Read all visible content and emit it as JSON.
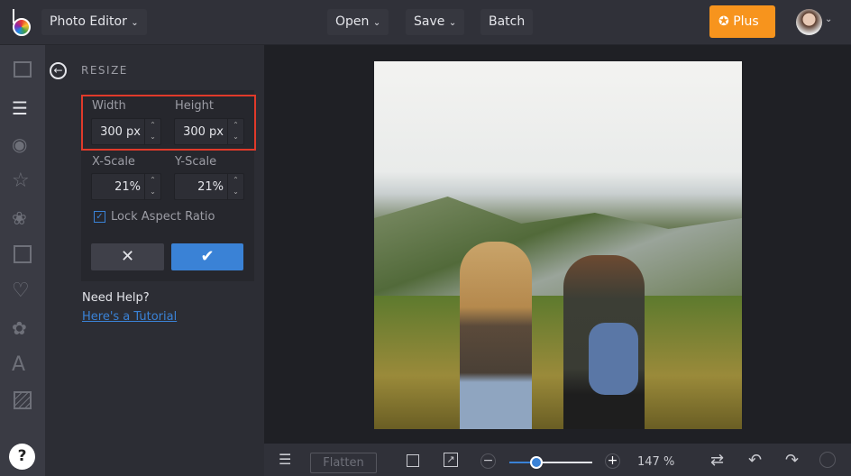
{
  "header": {
    "app_menu": "Photo Editor",
    "open": "Open",
    "save": "Save",
    "batch": "Batch",
    "plus": "Plus"
  },
  "panel": {
    "title": "RESIZE",
    "width_label": "Width",
    "height_label": "Height",
    "width_value": "300",
    "height_value": "300",
    "unit": "px",
    "xscale_label": "X-Scale",
    "yscale_label": "Y-Scale",
    "xscale_value": "21",
    "yscale_value": "21",
    "pct": "%",
    "lock_label": "Lock Aspect Ratio",
    "lock_checked": true,
    "help_title": "Need Help?",
    "help_link": "Here's a Tutorial"
  },
  "bottom": {
    "flatten": "Flatten",
    "zoom": "147 %",
    "zoom_fraction": 0.33
  },
  "colors": {
    "accent": "#3a82d6",
    "plus": "#f7941d",
    "highlight": "#e03a2a"
  }
}
